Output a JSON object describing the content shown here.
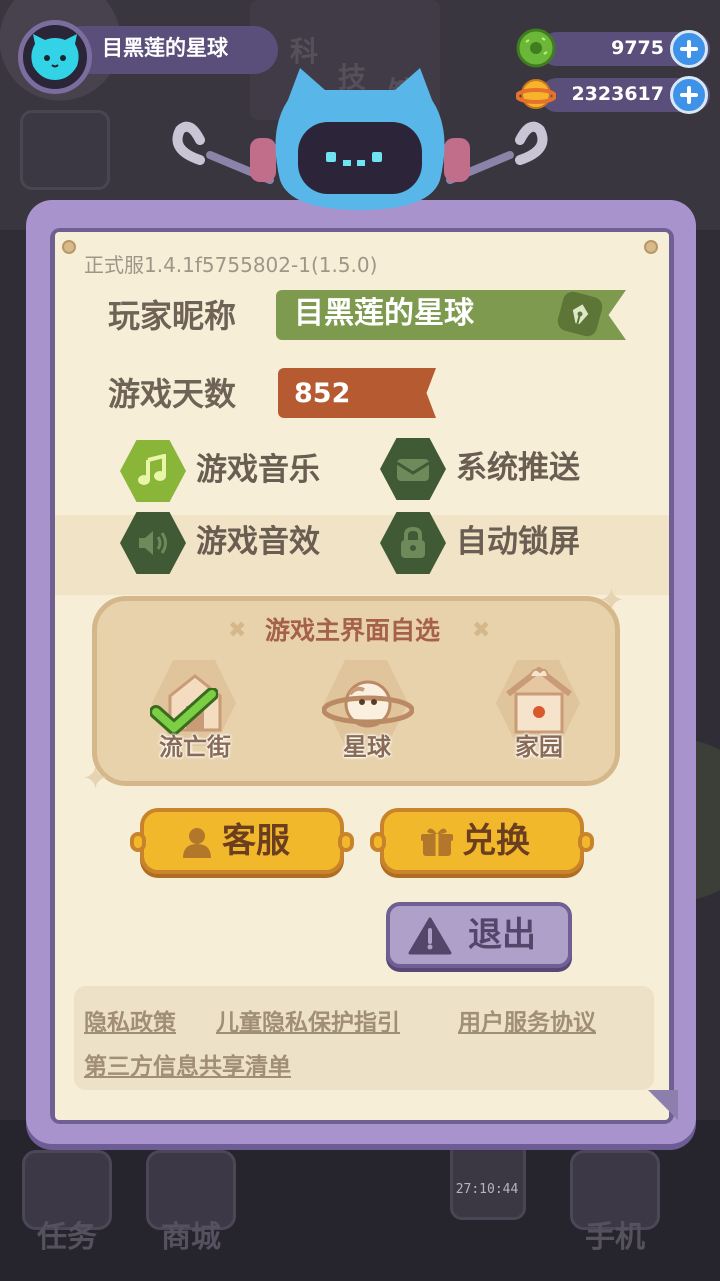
{
  "player": {
    "name": "目黑莲的星球"
  },
  "currencies": [
    {
      "icon": "green-donut-coin-icon",
      "value": "9775"
    },
    {
      "icon": "gold-planet-coin-icon",
      "value": "2323617"
    }
  ],
  "settings_panel": {
    "version": "正式服1.4.1f5755802-1(1.5.0)",
    "nickname_label": "玩家昵称",
    "nickname_value": "目黑莲的星球",
    "days_label": "游戏天数",
    "days_value": "852",
    "toggles": [
      {
        "label": "游戏音乐",
        "icon": "music-note-icon",
        "on": true
      },
      {
        "label": "系统推送",
        "icon": "envelope-icon",
        "on": false
      },
      {
        "label": "游戏音效",
        "icon": "speaker-icon",
        "on": false
      },
      {
        "label": "自动锁屏",
        "icon": "lock-icon",
        "on": false
      }
    ],
    "theme": {
      "title": "游戏主界面自选",
      "options": [
        {
          "label": "流亡街",
          "selected": true
        },
        {
          "label": "星球",
          "selected": false
        },
        {
          "label": "家园",
          "selected": false
        }
      ]
    },
    "buttons": {
      "support": "客服",
      "redeem": "兑换",
      "logout": "退出"
    },
    "links": [
      "隐私政策",
      "儿童隐私保护指引",
      "用户服务协议",
      "第三方信息共享清单"
    ]
  },
  "background": {
    "sign_chars": [
      "科",
      "技",
      "馆"
    ],
    "timer": "27:10:44",
    "nav": [
      "任务",
      "商城",
      "手机"
    ]
  },
  "colors": {
    "panel_border": "#a893cd",
    "paper": "#f7eed7",
    "toggle_on": "#89b539",
    "toggle_off": "#3f5a34",
    "gold_button": "#f2b82c",
    "accent_blue": "#3e92e8"
  }
}
